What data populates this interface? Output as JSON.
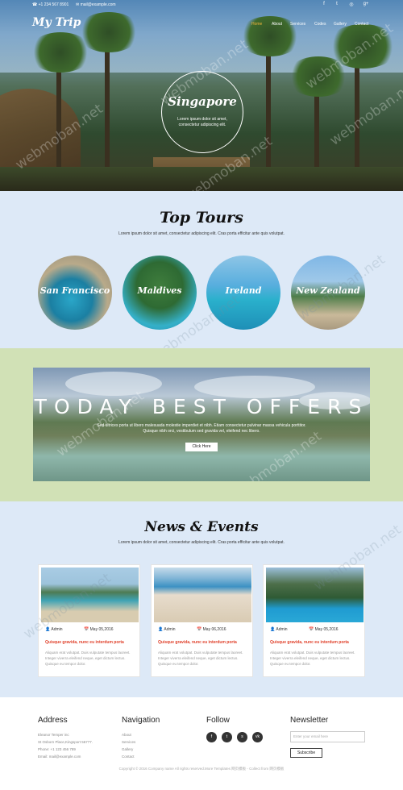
{
  "topbar": {
    "phone": "+1 234 567 8901",
    "email": "mail@example.com",
    "social_icons": [
      "facebook-icon",
      "twitter-icon",
      "dribbble-icon",
      "google-plus-icon"
    ]
  },
  "header": {
    "logo": "My Trip",
    "nav": [
      "Home",
      "About",
      "Services",
      "Codes",
      "Gallery",
      "Contact"
    ],
    "active_nav": "Home"
  },
  "hero": {
    "title": "Singapore",
    "subtitle": "Lorem ipsum dolor sit amet, consectetur adipiscing elit."
  },
  "tours": {
    "title": "Top Tours",
    "subtitle": "Lorem ipsum dolor sit amet, consectetur adipiscing elit. Cras porta efficitur ante quis volutpat.",
    "items": [
      {
        "name": "San Francisco"
      },
      {
        "name": "Maldives"
      },
      {
        "name": "Ireland"
      },
      {
        "name": "New Zealand"
      }
    ]
  },
  "offers": {
    "title": "TODAY BEST OFFERS",
    "description": "Sed ultrices porta ut libero malesuada molestie imperdiet et nibh. Etiam consectetur pulvinar massa vehicula porttitor. Quisque nibh orci, vestibulum sed gravida vel, eleifend nec libero.",
    "button": "Click Here"
  },
  "news": {
    "title": "News & Events",
    "subtitle": "Lorem ipsum dolor sit amet, consectetur adipiscing elit. Cras porta efficitur ante quis volutpat.",
    "items": [
      {
        "author": "Admin",
        "date": "May 05,2016",
        "title": "Quisque gravida, nunc eu interdum porta",
        "body": "Aliquam erat volutpat. Duis vulputate tempus laoreet. Integer viverra eleifend neque, eget dictum lectus. Quisque eu tempor dolor."
      },
      {
        "author": "Admin",
        "date": "May 06,2016",
        "title": "Quisque gravida, nunc eu interdum porta",
        "body": "Aliquam erat volutpat. Duis vulputate tempus laoreet. Integer viverra eleifend neque, eget dictum lectus. Quisque eu tempor dolor."
      },
      {
        "author": "Admin",
        "date": "May 05,2016",
        "title": "Quisque gravida, nunc eu interdum porta",
        "body": "Aliquam erat volutpat. Duis vulputate tempus laoreet. Integer viverra eleifend neque, eget dictum lectus. Quisque eu tempor dolor."
      }
    ]
  },
  "footer": {
    "address_title": "Address",
    "address_lines": [
      "Eleanor Temper inc",
      "St Osborn Place,Kingsport 56777.",
      "Phone: +1 123 456 789",
      "Email: mail@example.com"
    ],
    "nav_title": "Navigation",
    "nav_links": [
      "About",
      "Services",
      "Gallery",
      "Contact"
    ],
    "follow_title": "Follow",
    "follow_icons": [
      "facebook-icon",
      "twitter-icon",
      "skype-icon",
      "vk-icon"
    ],
    "newsletter_title": "Newsletter",
    "newsletter_placeholder": "Enter your email here",
    "subscribe": "Subscribe",
    "copyright": "Copyright © 2016 Company name All rights reserved.More Templates 网页模板 - Collect from 网页模板"
  },
  "watermark": "webmoban.net",
  "colors": {
    "accent": "#f0b43c",
    "news_title": "#e0402a",
    "tours_bg": "#dde9f7",
    "offers_band": "#d1e1b6"
  }
}
